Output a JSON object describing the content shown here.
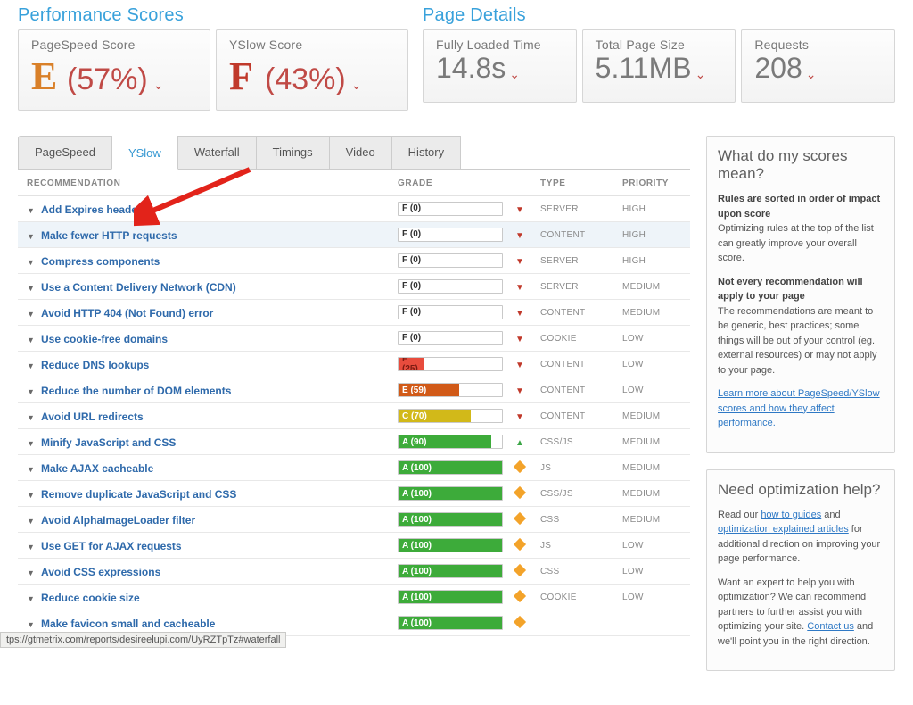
{
  "performance": {
    "title": "Performance Scores",
    "cards": [
      {
        "label": "PageSpeed Score",
        "grade": "E",
        "pct": "(57%)"
      },
      {
        "label": "YSlow Score",
        "grade": "F",
        "pct": "(43%)"
      }
    ]
  },
  "details": {
    "title": "Page Details",
    "cards": [
      {
        "label": "Fully Loaded Time",
        "value": "14.8s"
      },
      {
        "label": "Total Page Size",
        "value": "5.11MB"
      },
      {
        "label": "Requests",
        "value": "208"
      }
    ]
  },
  "tabs": [
    "PageSpeed",
    "YSlow",
    "Waterfall",
    "Timings",
    "Video",
    "History"
  ],
  "active_tab": "YSlow",
  "table": {
    "headers": {
      "rec": "RECOMMENDATION",
      "grade": "GRADE",
      "type": "TYPE",
      "pri": "PRIORITY"
    },
    "rows": [
      {
        "name": "Add Expires headers",
        "gradeText": "F (0)",
        "fill": 0,
        "color": "#fff",
        "txt": "#333",
        "ico": "down",
        "type": "SERVER",
        "pri": "HIGH"
      },
      {
        "name": "Make fewer HTTP requests",
        "gradeText": "F (0)",
        "fill": 0,
        "color": "#fff",
        "txt": "#333",
        "ico": "down",
        "type": "CONTENT",
        "pri": "HIGH",
        "hl": true
      },
      {
        "name": "Compress components",
        "gradeText": "F (0)",
        "fill": 0,
        "color": "#fff",
        "txt": "#333",
        "ico": "down",
        "type": "SERVER",
        "pri": "HIGH"
      },
      {
        "name": "Use a Content Delivery Network (CDN)",
        "gradeText": "F (0)",
        "fill": 0,
        "color": "#fff",
        "txt": "#333",
        "ico": "down",
        "type": "SERVER",
        "pri": "MEDIUM"
      },
      {
        "name": "Avoid HTTP 404 (Not Found) error",
        "gradeText": "F (0)",
        "fill": 0,
        "color": "#fff",
        "txt": "#333",
        "ico": "down",
        "type": "CONTENT",
        "pri": "MEDIUM"
      },
      {
        "name": "Use cookie-free domains",
        "gradeText": "F (0)",
        "fill": 0,
        "color": "#fff",
        "txt": "#333",
        "ico": "down",
        "type": "COOKIE",
        "pri": "LOW"
      },
      {
        "name": "Reduce DNS lookups",
        "gradeText": "F (25)",
        "fill": 25,
        "color": "#e84c3d",
        "txt": "#7a1a11",
        "ico": "down",
        "type": "CONTENT",
        "pri": "LOW"
      },
      {
        "name": "Reduce the number of DOM elements",
        "gradeText": "E (59)",
        "fill": 59,
        "color": "#d15a18",
        "txt": "#fff",
        "ico": "down",
        "type": "CONTENT",
        "pri": "LOW"
      },
      {
        "name": "Avoid URL redirects",
        "gradeText": "C (70)",
        "fill": 70,
        "color": "#d2b919",
        "txt": "#fff",
        "ico": "down",
        "type": "CONTENT",
        "pri": "MEDIUM"
      },
      {
        "name": "Minify JavaScript and CSS",
        "gradeText": "A (90)",
        "fill": 90,
        "color": "#3dab3a",
        "txt": "#fff",
        "ico": "up",
        "type": "CSS/JS",
        "pri": "MEDIUM"
      },
      {
        "name": "Make AJAX cacheable",
        "gradeText": "A (100)",
        "fill": 100,
        "color": "#3dab3a",
        "txt": "#fff",
        "ico": "eq",
        "type": "JS",
        "pri": "MEDIUM"
      },
      {
        "name": "Remove duplicate JavaScript and CSS",
        "gradeText": "A (100)",
        "fill": 100,
        "color": "#3dab3a",
        "txt": "#fff",
        "ico": "eq",
        "type": "CSS/JS",
        "pri": "MEDIUM"
      },
      {
        "name": "Avoid AlphaImageLoader filter",
        "gradeText": "A (100)",
        "fill": 100,
        "color": "#3dab3a",
        "txt": "#fff",
        "ico": "eq",
        "type": "CSS",
        "pri": "MEDIUM"
      },
      {
        "name": "Use GET for AJAX requests",
        "gradeText": "A (100)",
        "fill": 100,
        "color": "#3dab3a",
        "txt": "#fff",
        "ico": "eq",
        "type": "JS",
        "pri": "LOW"
      },
      {
        "name": "Avoid CSS expressions",
        "gradeText": "A (100)",
        "fill": 100,
        "color": "#3dab3a",
        "txt": "#fff",
        "ico": "eq",
        "type": "CSS",
        "pri": "LOW"
      },
      {
        "name": "Reduce cookie size",
        "gradeText": "A (100)",
        "fill": 100,
        "color": "#3dab3a",
        "txt": "#fff",
        "ico": "eq",
        "type": "COOKIE",
        "pri": "LOW"
      },
      {
        "name": "Make favicon small and cacheable",
        "gradeText": "A (100)",
        "fill": 100,
        "color": "#3dab3a",
        "txt": "#fff",
        "ico": "eq",
        "type": "",
        "pri": ""
      }
    ]
  },
  "sidebar": {
    "box1": {
      "title": "What do my scores mean?",
      "bold1": "Rules are sorted in order of impact upon score",
      "text1": "Optimizing rules at the top of the list can greatly improve your overall score.",
      "bold2": "Not every recommendation will apply to your page",
      "text2": "The recommendations are meant to be generic, best practices; some things will be out of your control (eg. external resources) or may not apply to your page.",
      "link": "Learn more about PageSpeed/YSlow scores and how they affect performance."
    },
    "box2": {
      "title": "Need optimization help?",
      "text1a": "Read our ",
      "link1": "how to guides",
      "text1b": " and ",
      "link2": "optimization explained articles",
      "text1c": " for additional direction on improving your page performance.",
      "text2a": "Want an expert to help you with optimization? We can recommend partners to further assist you with optimizing your site. ",
      "link3": "Contact us",
      "text2b": " and we'll point you in the right direction."
    }
  },
  "status_url": "tps://gtmetrix.com/reports/desireelupi.com/UyRZTpTz#waterfall"
}
